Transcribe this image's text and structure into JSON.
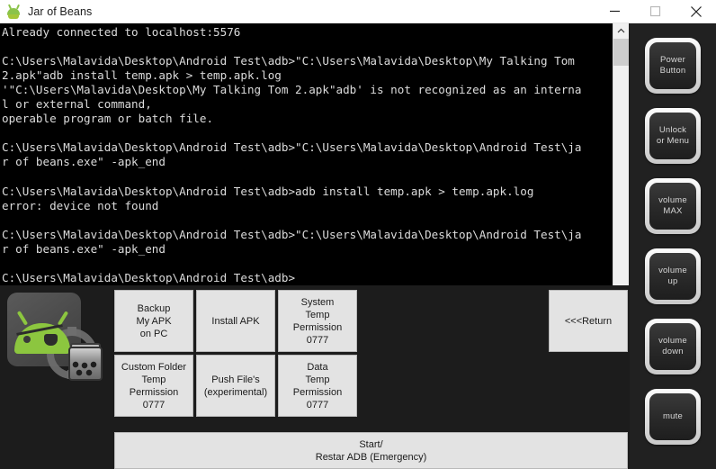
{
  "window": {
    "title": "Jar of Beans",
    "icon": "android-icon",
    "controls": {
      "minimize": "minimize-icon",
      "maximize": "maximize-icon",
      "close": "close-icon"
    }
  },
  "console": {
    "text": "Already connected to localhost:5576\n\nC:\\Users\\Malavida\\Desktop\\Android Test\\adb>\"C:\\Users\\Malavida\\Desktop\\My Talking Tom\n2.apk\"adb install temp.apk > temp.apk.log\n'\"C:\\Users\\Malavida\\Desktop\\My Talking Tom 2.apk\"adb' is not recognized as an interna\nl or external command,\noperable program or batch file.\n\nC:\\Users\\Malavida\\Desktop\\Android Test\\adb>\"C:\\Users\\Malavida\\Desktop\\Android Test\\ja\nr of beans.exe\" -apk_end\n\nC:\\Users\\Malavida\\Desktop\\Android Test\\adb>adb install temp.apk > temp.apk.log\nerror: device not found\n\nC:\\Users\\Malavida\\Desktop\\Android Test\\adb>\"C:\\Users\\Malavida\\Desktop\\Android Test\\ja\nr of beans.exe\" -apk_end\n\nC:\\Users\\Malavida\\Desktop\\Android Test\\adb>"
  },
  "scrollbar": {
    "up_arrow": "chevron-up-icon"
  },
  "sidebar": {
    "buttons": [
      {
        "label": "Power\nButton",
        "name": "power-button"
      },
      {
        "label": "Unlock\nor Menu",
        "name": "unlock-or-menu-button"
      },
      {
        "label": "volume\nMAX",
        "name": "volume-max-button"
      },
      {
        "label": "volume\nup",
        "name": "volume-up-button"
      },
      {
        "label": "volume\ndown",
        "name": "volume-down-button"
      },
      {
        "label": "mute",
        "name": "mute-button"
      }
    ]
  },
  "bottom": {
    "logo": "android-pirate-jar-logo",
    "grid_buttons": [
      {
        "label": "Backup\nMy APK\non PC",
        "name": "backup-my-apk-on-pc-button"
      },
      {
        "label": "Install APK",
        "name": "install-apk-button"
      },
      {
        "label": "System\nTemp\nPermission\n0777",
        "name": "system-temp-permission-button"
      },
      {
        "label": "Custom Folder\nTemp\nPermission\n0777",
        "name": "custom-folder-temp-permission-button"
      },
      {
        "label": "Push File's\n(experimental)",
        "name": "push-files-button"
      },
      {
        "label": "Data\nTemp\nPermission\n0777",
        "name": "data-temp-permission-button"
      }
    ],
    "return_button": "<<<Return",
    "adb_button": "Start/\nRestar ADB (Emergency)"
  },
  "colors": {
    "console_bg": "#000000",
    "console_text": "#dcdcdc",
    "panel_bg": "#1c1c1c",
    "sidebar_bg": "#212121",
    "flat_button_bg": "#e3e3e3",
    "android_green": "#8cc63f"
  }
}
